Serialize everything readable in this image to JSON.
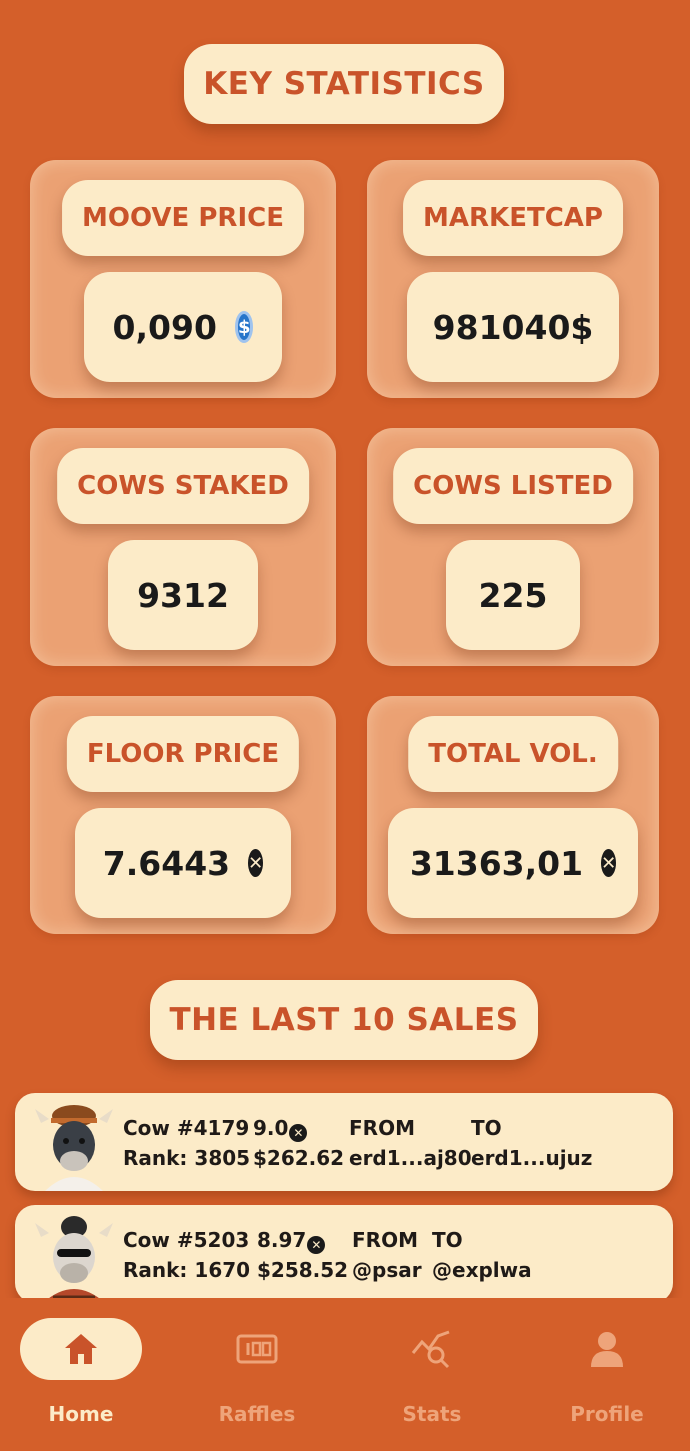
{
  "headings": {
    "key_statistics": "KEY STATISTICS",
    "last_sales": "THE LAST 10 SALES"
  },
  "stats": {
    "moove_price": {
      "label": "MOOVE PRICE",
      "value": "0,090",
      "icon": "usdc-icon"
    },
    "marketcap": {
      "label": "MARKETCAP",
      "value": "981040$"
    },
    "cows_staked": {
      "label": "COWS STAKED",
      "value": "9312"
    },
    "cows_listed": {
      "label": "COWS LISTED",
      "value": "225"
    },
    "floor_price": {
      "label": "FLOOR PRICE",
      "value": "7.6443",
      "icon": "egld-icon"
    },
    "total_vol": {
      "label": "TOTAL VOL.",
      "value": "31363,01",
      "icon": "egld-icon"
    }
  },
  "sales": [
    {
      "name": "Cow #4179",
      "rank": "Rank: 3805",
      "price": "9.0",
      "usd": "$262.62",
      "from_label": "FROM",
      "from": "erd1...aj80",
      "to_label": "TO",
      "to": "erd1...ujuz"
    },
    {
      "name": "Cow #5203",
      "rank": "Rank: 1670",
      "price": "8.97",
      "usd": "$258.52",
      "from_label": "FROM",
      "from": "@psar",
      "to_label": "TO",
      "to": "@explwa"
    }
  ],
  "nav": {
    "home": "Home",
    "raffles": "Raffles",
    "stats": "Stats",
    "profile": "Profile",
    "active": "home"
  },
  "colors": {
    "background": "#d45f2a",
    "cream": "#fcebc8",
    "card": "#eba173",
    "accent_text": "#c9532a"
  }
}
